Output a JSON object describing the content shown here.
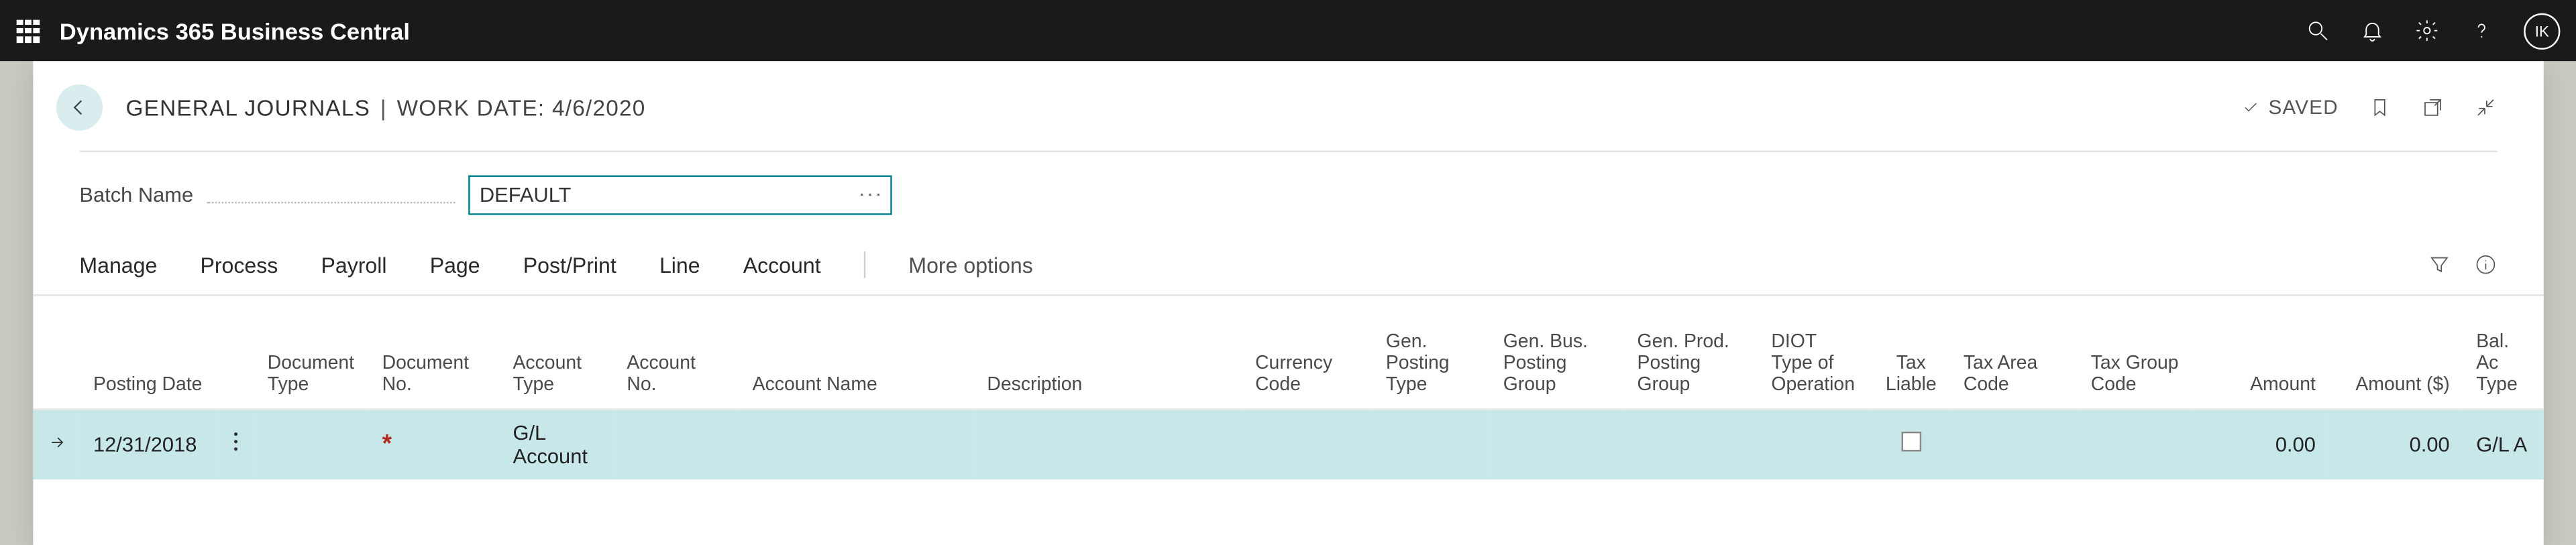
{
  "brand": "Dynamics 365 Business Central",
  "avatar_initials": "IK",
  "header": {
    "back_aria": "Back",
    "crumb_main": "General Journals",
    "crumb_sep": "|",
    "crumb_workdate_label": "Work Date:",
    "crumb_workdate_value": "4/6/2020",
    "saved_label": "Saved"
  },
  "batch": {
    "label": "Batch Name",
    "value": "DEFAULT"
  },
  "commands": {
    "items": [
      "Manage",
      "Process",
      "Payroll",
      "Page",
      "Post/Print",
      "Line",
      "Account"
    ],
    "more": "More options"
  },
  "columns": {
    "posting_date": "Posting Date",
    "document_type": "Document Type",
    "document_no": "Document No.",
    "account_type": "Account Type",
    "account_no": "Account No.",
    "account_name": "Account Name",
    "description": "Description",
    "currency_code": "Currency Code",
    "gen_posting_type": "Gen. Posting Type",
    "gen_bus_posting_group": "Gen. Bus. Posting Group",
    "gen_prod_posting_group": "Gen. Prod. Posting Group",
    "diot_type": "DIOT Type of Operation",
    "tax_liable": "Tax Liable",
    "tax_area_code": "Tax Area Code",
    "tax_group_code": "Tax Group Code",
    "amount": "Amount",
    "amount_usd": "Amount ($)",
    "bal_account_type": "Bal. Ac Type"
  },
  "row": {
    "posting_date": "12/31/2018",
    "document_type": "",
    "document_no": "",
    "account_type": "G/L Account",
    "account_no": "",
    "account_name": "",
    "description": "",
    "currency_code": "",
    "gen_posting_type": "",
    "gen_bus_posting_group": "",
    "gen_prod_posting_group": "",
    "diot_type": "",
    "tax_area_code": "",
    "tax_group_code": "",
    "amount": "0.00",
    "amount_usd": "0.00",
    "bal_account_type": "G/L A"
  }
}
